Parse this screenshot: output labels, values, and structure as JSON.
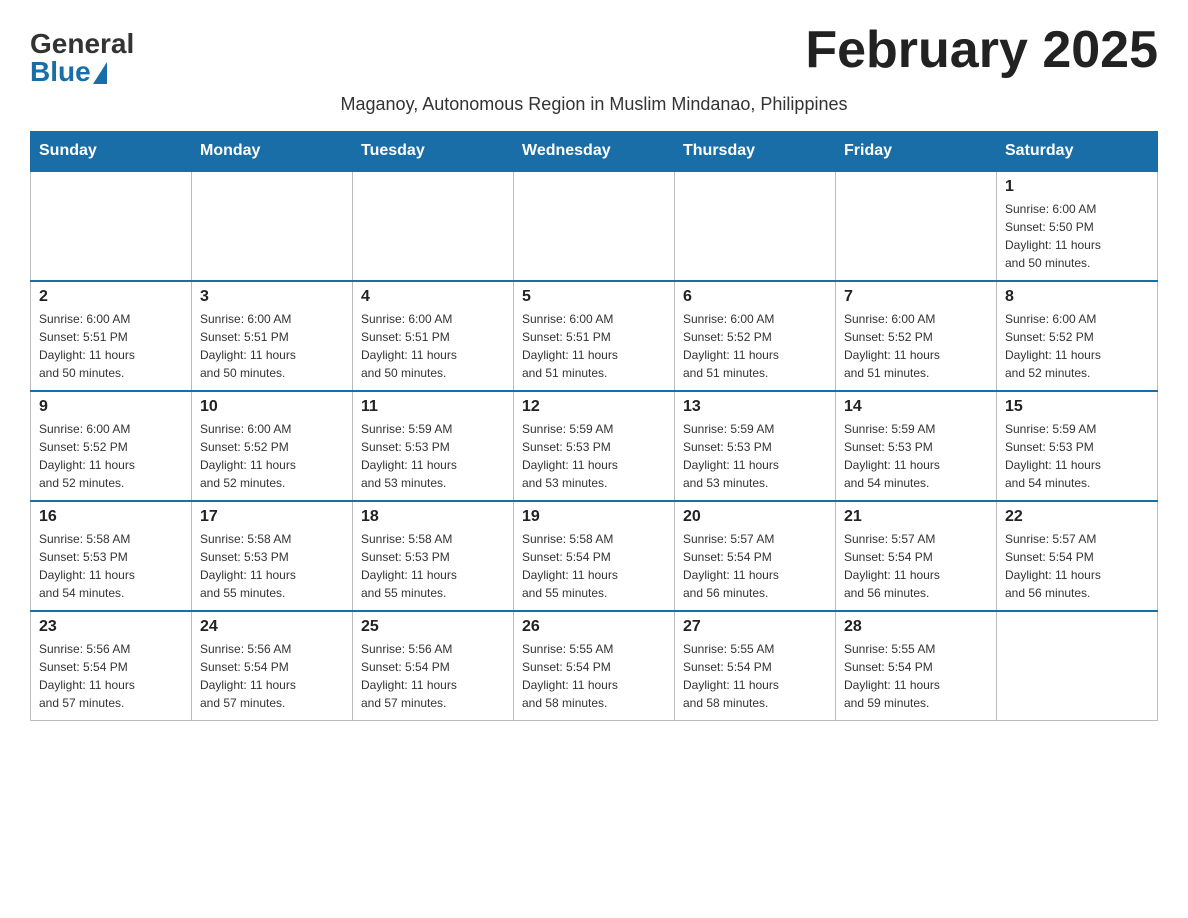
{
  "logo": {
    "general": "General",
    "blue": "Blue"
  },
  "title": "February 2025",
  "subtitle": "Maganoy, Autonomous Region in Muslim Mindanao, Philippines",
  "days_of_week": [
    "Sunday",
    "Monday",
    "Tuesday",
    "Wednesday",
    "Thursday",
    "Friday",
    "Saturday"
  ],
  "weeks": [
    [
      {
        "day": "",
        "info": ""
      },
      {
        "day": "",
        "info": ""
      },
      {
        "day": "",
        "info": ""
      },
      {
        "day": "",
        "info": ""
      },
      {
        "day": "",
        "info": ""
      },
      {
        "day": "",
        "info": ""
      },
      {
        "day": "1",
        "info": "Sunrise: 6:00 AM\nSunset: 5:50 PM\nDaylight: 11 hours\nand 50 minutes."
      }
    ],
    [
      {
        "day": "2",
        "info": "Sunrise: 6:00 AM\nSunset: 5:51 PM\nDaylight: 11 hours\nand 50 minutes."
      },
      {
        "day": "3",
        "info": "Sunrise: 6:00 AM\nSunset: 5:51 PM\nDaylight: 11 hours\nand 50 minutes."
      },
      {
        "day": "4",
        "info": "Sunrise: 6:00 AM\nSunset: 5:51 PM\nDaylight: 11 hours\nand 50 minutes."
      },
      {
        "day": "5",
        "info": "Sunrise: 6:00 AM\nSunset: 5:51 PM\nDaylight: 11 hours\nand 51 minutes."
      },
      {
        "day": "6",
        "info": "Sunrise: 6:00 AM\nSunset: 5:52 PM\nDaylight: 11 hours\nand 51 minutes."
      },
      {
        "day": "7",
        "info": "Sunrise: 6:00 AM\nSunset: 5:52 PM\nDaylight: 11 hours\nand 51 minutes."
      },
      {
        "day": "8",
        "info": "Sunrise: 6:00 AM\nSunset: 5:52 PM\nDaylight: 11 hours\nand 52 minutes."
      }
    ],
    [
      {
        "day": "9",
        "info": "Sunrise: 6:00 AM\nSunset: 5:52 PM\nDaylight: 11 hours\nand 52 minutes."
      },
      {
        "day": "10",
        "info": "Sunrise: 6:00 AM\nSunset: 5:52 PM\nDaylight: 11 hours\nand 52 minutes."
      },
      {
        "day": "11",
        "info": "Sunrise: 5:59 AM\nSunset: 5:53 PM\nDaylight: 11 hours\nand 53 minutes."
      },
      {
        "day": "12",
        "info": "Sunrise: 5:59 AM\nSunset: 5:53 PM\nDaylight: 11 hours\nand 53 minutes."
      },
      {
        "day": "13",
        "info": "Sunrise: 5:59 AM\nSunset: 5:53 PM\nDaylight: 11 hours\nand 53 minutes."
      },
      {
        "day": "14",
        "info": "Sunrise: 5:59 AM\nSunset: 5:53 PM\nDaylight: 11 hours\nand 54 minutes."
      },
      {
        "day": "15",
        "info": "Sunrise: 5:59 AM\nSunset: 5:53 PM\nDaylight: 11 hours\nand 54 minutes."
      }
    ],
    [
      {
        "day": "16",
        "info": "Sunrise: 5:58 AM\nSunset: 5:53 PM\nDaylight: 11 hours\nand 54 minutes."
      },
      {
        "day": "17",
        "info": "Sunrise: 5:58 AM\nSunset: 5:53 PM\nDaylight: 11 hours\nand 55 minutes."
      },
      {
        "day": "18",
        "info": "Sunrise: 5:58 AM\nSunset: 5:53 PM\nDaylight: 11 hours\nand 55 minutes."
      },
      {
        "day": "19",
        "info": "Sunrise: 5:58 AM\nSunset: 5:54 PM\nDaylight: 11 hours\nand 55 minutes."
      },
      {
        "day": "20",
        "info": "Sunrise: 5:57 AM\nSunset: 5:54 PM\nDaylight: 11 hours\nand 56 minutes."
      },
      {
        "day": "21",
        "info": "Sunrise: 5:57 AM\nSunset: 5:54 PM\nDaylight: 11 hours\nand 56 minutes."
      },
      {
        "day": "22",
        "info": "Sunrise: 5:57 AM\nSunset: 5:54 PM\nDaylight: 11 hours\nand 56 minutes."
      }
    ],
    [
      {
        "day": "23",
        "info": "Sunrise: 5:56 AM\nSunset: 5:54 PM\nDaylight: 11 hours\nand 57 minutes."
      },
      {
        "day": "24",
        "info": "Sunrise: 5:56 AM\nSunset: 5:54 PM\nDaylight: 11 hours\nand 57 minutes."
      },
      {
        "day": "25",
        "info": "Sunrise: 5:56 AM\nSunset: 5:54 PM\nDaylight: 11 hours\nand 57 minutes."
      },
      {
        "day": "26",
        "info": "Sunrise: 5:55 AM\nSunset: 5:54 PM\nDaylight: 11 hours\nand 58 minutes."
      },
      {
        "day": "27",
        "info": "Sunrise: 5:55 AM\nSunset: 5:54 PM\nDaylight: 11 hours\nand 58 minutes."
      },
      {
        "day": "28",
        "info": "Sunrise: 5:55 AM\nSunset: 5:54 PM\nDaylight: 11 hours\nand 59 minutes."
      },
      {
        "day": "",
        "info": ""
      }
    ]
  ],
  "colors": {
    "header_bg": "#1a6ea8",
    "header_text": "#ffffff",
    "border": "#bbbbbb"
  }
}
